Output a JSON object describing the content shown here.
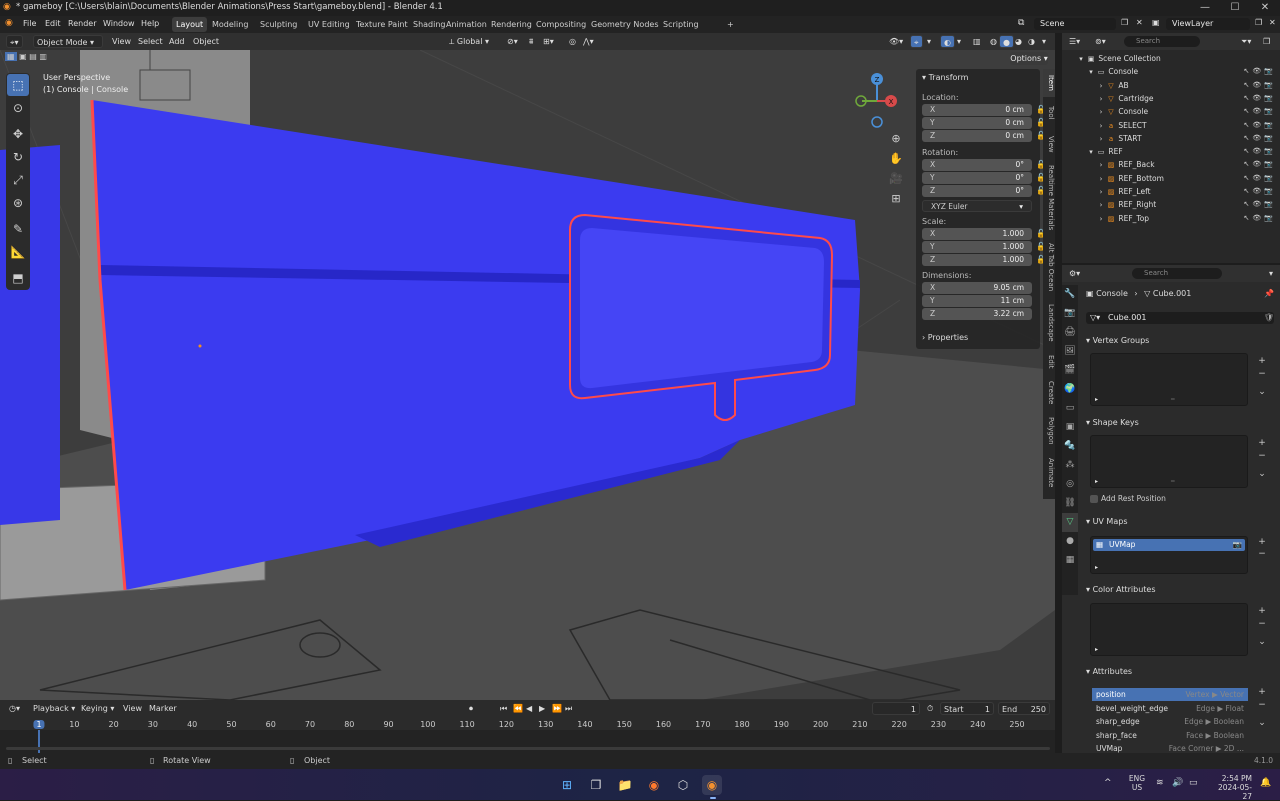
{
  "window": {
    "title": "* gameboy [C:\\Users\\blain\\Documents\\Blender Animations\\Press Start\\gameboy.blend] - Blender 4.1",
    "minimize": "—",
    "maximize": "☐",
    "close": "✕"
  },
  "menu": {
    "file": "File",
    "edit": "Edit",
    "render": "Render",
    "window": "Window",
    "help": "Help"
  },
  "workspaces": [
    "Layout",
    "Modeling",
    "Sculpting",
    "UV Editing",
    "Texture Paint",
    "Shading",
    "Animation",
    "Rendering",
    "Compositing",
    "Geometry Nodes",
    "Scripting"
  ],
  "workspace_add": "+",
  "scene": {
    "label": "Scene",
    "view_layer": "ViewLayer"
  },
  "viewport_header": {
    "mode": "Object Mode",
    "view": "View",
    "select": "Select",
    "add": "Add",
    "object": "Object",
    "orientation": "Global",
    "options": "Options"
  },
  "viewport": {
    "perspective": "User Perspective",
    "context": "(1) Console | Console"
  },
  "gizmo": {
    "x": "X",
    "y": "Y",
    "z": "Z"
  },
  "npanel": {
    "transform_title": "Transform",
    "location_label": "Location:",
    "location": [
      {
        "axis": "X",
        "value": "0 cm"
      },
      {
        "axis": "Y",
        "value": "0 cm"
      },
      {
        "axis": "Z",
        "value": "0 cm"
      }
    ],
    "rotation_label": "Rotation:",
    "rotation": [
      {
        "axis": "X",
        "value": "0°"
      },
      {
        "axis": "Y",
        "value": "0°"
      },
      {
        "axis": "Z",
        "value": "0°"
      }
    ],
    "rotation_mode": "XYZ Euler",
    "scale_label": "Scale:",
    "scale": [
      {
        "axis": "X",
        "value": "1.000"
      },
      {
        "axis": "Y",
        "value": "1.000"
      },
      {
        "axis": "Z",
        "value": "1.000"
      }
    ],
    "dimensions_label": "Dimensions:",
    "dimensions": [
      {
        "axis": "X",
        "value": "9.05 cm"
      },
      {
        "axis": "Y",
        "value": "11 cm"
      },
      {
        "axis": "Z",
        "value": "3.22 cm"
      }
    ],
    "properties_title": "Properties"
  },
  "ntabs": [
    "Item",
    "Tool",
    "View",
    "Realtime Materials",
    "Alt Tab Ocean",
    "Landscape",
    "Edit",
    "Create",
    "Polygon",
    "Animate"
  ],
  "outliner": {
    "search_placeholder": "Search",
    "rows": [
      {
        "indent": 0,
        "label": "Scene Collection"
      },
      {
        "indent": 1,
        "label": "Console"
      },
      {
        "indent": 2,
        "label": "AB"
      },
      {
        "indent": 2,
        "label": "Cartridge"
      },
      {
        "indent": 2,
        "label": "Console"
      },
      {
        "indent": 2,
        "label": "SELECT"
      },
      {
        "indent": 2,
        "label": "START"
      },
      {
        "indent": 1,
        "label": "REF"
      },
      {
        "indent": 2,
        "label": "REF_Back"
      },
      {
        "indent": 2,
        "label": "REF_Bottom"
      },
      {
        "indent": 2,
        "label": "REF_Left"
      },
      {
        "indent": 2,
        "label": "REF_Right"
      },
      {
        "indent": 2,
        "label": "REF_Top"
      }
    ]
  },
  "properties": {
    "search_placeholder": "Search",
    "breadcrumb_object": "Console",
    "breadcrumb_sep": "›",
    "breadcrumb_mesh": "Cube.001",
    "mesh_name": "Cube.001",
    "vertex_groups": "Vertex Groups",
    "shape_keys": "Shape Keys",
    "add_rest_position": "Add Rest Position",
    "uv_maps": "UV Maps",
    "uv_map_item": "UVMap",
    "color_attributes": "Color Attributes",
    "attributes": "Attributes",
    "attribute_rows": [
      {
        "name": "position",
        "domain": "Vertex ▶ Vector"
      },
      {
        "name": "bevel_weight_edge",
        "domain": "Edge ▶ Float"
      },
      {
        "name": "sharp_edge",
        "domain": "Edge ▶ Boolean"
      },
      {
        "name": "sharp_face",
        "domain": "Face ▶ Boolean"
      },
      {
        "name": "UVMap",
        "domain": "Face Corner ▶ 2D ..."
      }
    ]
  },
  "timeline": {
    "playback": "Playback",
    "keying": "Keying",
    "view": "View",
    "marker": "Marker",
    "current_frame": "1",
    "start_label": "Start",
    "start": "1",
    "end_label": "End",
    "end": "250",
    "frames": [
      "1",
      "10",
      "20",
      "30",
      "40",
      "50",
      "60",
      "70",
      "80",
      "90",
      "100",
      "110",
      "120",
      "130",
      "140",
      "150",
      "160",
      "170",
      "180",
      "190",
      "200",
      "210",
      "220",
      "230",
      "240",
      "250"
    ]
  },
  "status": {
    "select": "Select",
    "rotate": "Rotate View",
    "object": "Object",
    "version": "4.1.0"
  },
  "taskbar": {
    "lang": "ENG",
    "region": "US",
    "time": "2:54 PM",
    "date": "2024-05-27"
  },
  "colors": {
    "accent": "#4772b3",
    "mesh": "#3b3bf0",
    "edge_highlight": "#ff4a4a"
  }
}
